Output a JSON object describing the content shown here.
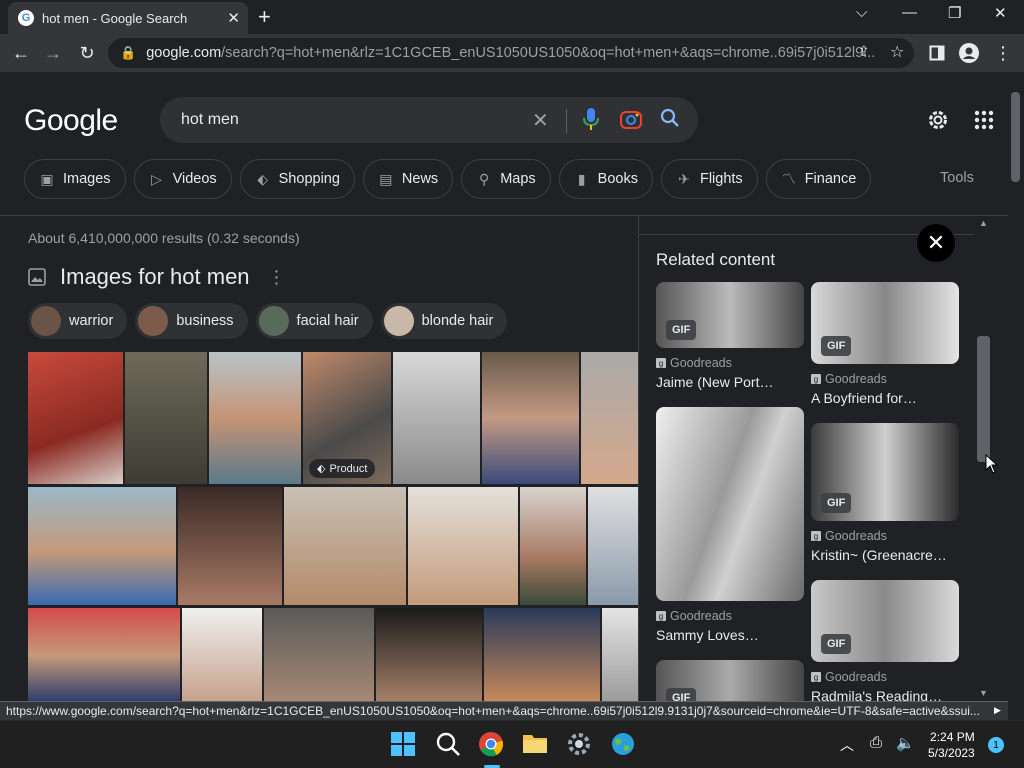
{
  "browser": {
    "tab_title": "hot men - Google Search",
    "url_host": "google.com",
    "url_path": "/search?q=hot+men&rlz=1C1GCEB_enUS1050US1050&oq=hot+men+&aqs=chrome..69i57j0i512l9..."
  },
  "search": {
    "logo": "Google",
    "query": "hot men",
    "tabs": [
      {
        "label": "Images",
        "icon": "image-icon"
      },
      {
        "label": "Videos",
        "icon": "play-icon"
      },
      {
        "label": "Shopping",
        "icon": "tag-icon"
      },
      {
        "label": "News",
        "icon": "newspaper-icon"
      },
      {
        "label": "Maps",
        "icon": "pin-icon"
      },
      {
        "label": "Books",
        "icon": "book-icon"
      },
      {
        "label": "Flights",
        "icon": "plane-icon"
      },
      {
        "label": "Finance",
        "icon": "chart-icon"
      }
    ],
    "tools": "Tools"
  },
  "results": {
    "stats": "About 6,410,000,000 results (0.32 seconds)",
    "images_heading": "Images for hot men",
    "refinements": [
      "warrior",
      "business",
      "facial hair",
      "blonde hair"
    ],
    "product_badge": "Product"
  },
  "related": {
    "title": "Related content",
    "cards": [
      {
        "source": "Goodreads",
        "caption": "Jaime (New Port…",
        "gif": "GIF"
      },
      {
        "source": "Goodreads",
        "caption": "A Boyfriend for…",
        "gif": "GIF"
      },
      {
        "source": "Goodreads",
        "caption": "Sammy Loves…",
        "gif": ""
      },
      {
        "source": "Goodreads",
        "caption": "Kristin~ (Greenacre…",
        "gif": "GIF"
      },
      {
        "source": "Goodreads",
        "caption": "Radmila's Reading…",
        "gif": "GIF"
      },
      {
        "source": "",
        "caption": "",
        "gif": "GIF"
      }
    ]
  },
  "status_url": "https://www.google.com/search?q=hot+men&rlz=1C1GCEB_enUS1050US1050&oq=hot+men+&aqs=chrome..69i57j0i512l9.9131j0j7&sourceid=chrome&ie=UTF-8&safe=active&ssui...",
  "taskbar": {
    "time": "2:24 PM",
    "date": "5/3/2023",
    "notification_count": "1"
  },
  "colors": {
    "background": "#202124",
    "chrome_toolbar": "#35363a",
    "accent_blue": "#8ab4f8"
  }
}
